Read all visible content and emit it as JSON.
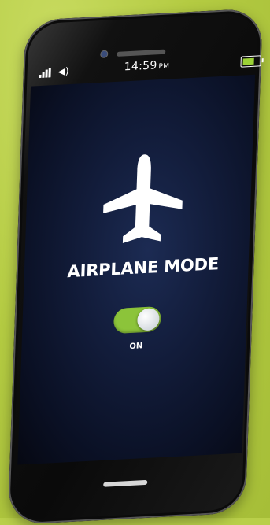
{
  "status_bar": {
    "time": "14:59",
    "ampm": "PM",
    "battery_level": 0.85
  },
  "main": {
    "title": "AIRPLANE MODE",
    "toggle_state_label": "ON",
    "toggle_on": true
  },
  "colors": {
    "toggle_accent": "#8cc43a",
    "background_green": "#b9cf4a",
    "screen_blue": "#121c3a"
  },
  "icons": [
    "signal-icon",
    "volume-icon",
    "battery-icon",
    "airplane-icon"
  ]
}
